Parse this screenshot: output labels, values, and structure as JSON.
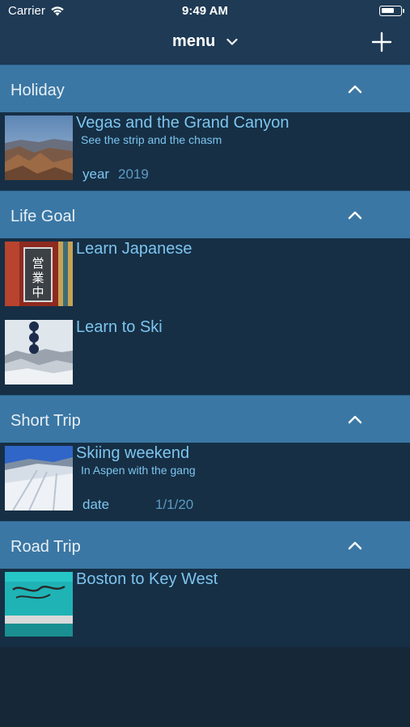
{
  "status_bar": {
    "carrier": "Carrier",
    "time": "9:49 AM",
    "battery_level": 0.7
  },
  "nav": {
    "title": "menu",
    "dropdown_icon": "chevron-down-icon",
    "add_icon": "plus-icon"
  },
  "colors": {
    "background": "#162838",
    "bar": "#1e3a55",
    "section_header": "#3b77a4",
    "row": "#162f45",
    "accent_text": "#7dc5ef"
  },
  "sections": [
    {
      "title": "Holiday",
      "items": [
        {
          "title": "Vegas and the Grand Canyon",
          "subtitle": "See the strip and the chasm",
          "field_label": "year",
          "field_value": "2019",
          "thumbnail": "canyon-photo"
        }
      ]
    },
    {
      "title": "Life Goal",
      "items": [
        {
          "title": "Learn Japanese",
          "thumbnail": "japanese-sign-photo"
        },
        {
          "title": "Learn to Ski",
          "thumbnail": "ski-slope-photo"
        }
      ]
    },
    {
      "title": "Short Trip",
      "items": [
        {
          "title": "Skiing weekend",
          "subtitle": "In Aspen with the gang",
          "field_label": "date",
          "field_value": "1/1/20",
          "thumbnail": "snow-run-photo"
        }
      ]
    },
    {
      "title": "Road Trip",
      "items": [
        {
          "title": "Boston to Key West",
          "thumbnail": "cape-cod-sign-photo"
        }
      ]
    }
  ]
}
